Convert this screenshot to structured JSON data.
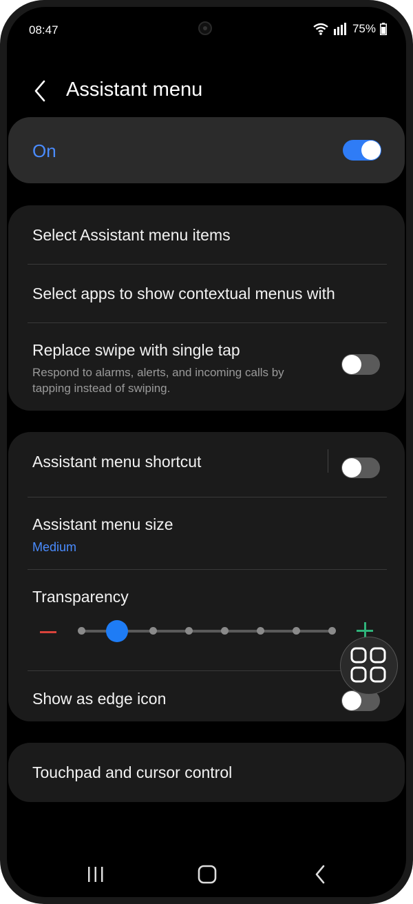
{
  "status_bar": {
    "time": "08:47",
    "battery": "75%"
  },
  "header": {
    "title": "Assistant menu"
  },
  "master": {
    "label": "On",
    "enabled": true
  },
  "group1": {
    "select_items": "Select Assistant menu items",
    "select_apps": "Select apps to show contextual menus with",
    "replace_swipe": {
      "label": "Replace swipe with single tap",
      "description": "Respond to alarms, alerts, and incoming calls by tapping instead of swiping.",
      "enabled": false
    }
  },
  "group2": {
    "shortcut": {
      "label": "Assistant menu shortcut",
      "enabled": false
    },
    "size": {
      "label": "Assistant menu size",
      "value": "Medium"
    },
    "transparency": {
      "label": "Transparency",
      "level_index": 1,
      "levels": 8
    },
    "edge_icon": {
      "label": "Show as edge icon",
      "enabled": false
    }
  },
  "group3": {
    "touchpad": "Touchpad and cursor control"
  },
  "colors": {
    "accent": "#2f7cf6",
    "link": "#4a8cff",
    "minus": "#d9433b",
    "plus": "#2fb37a"
  }
}
